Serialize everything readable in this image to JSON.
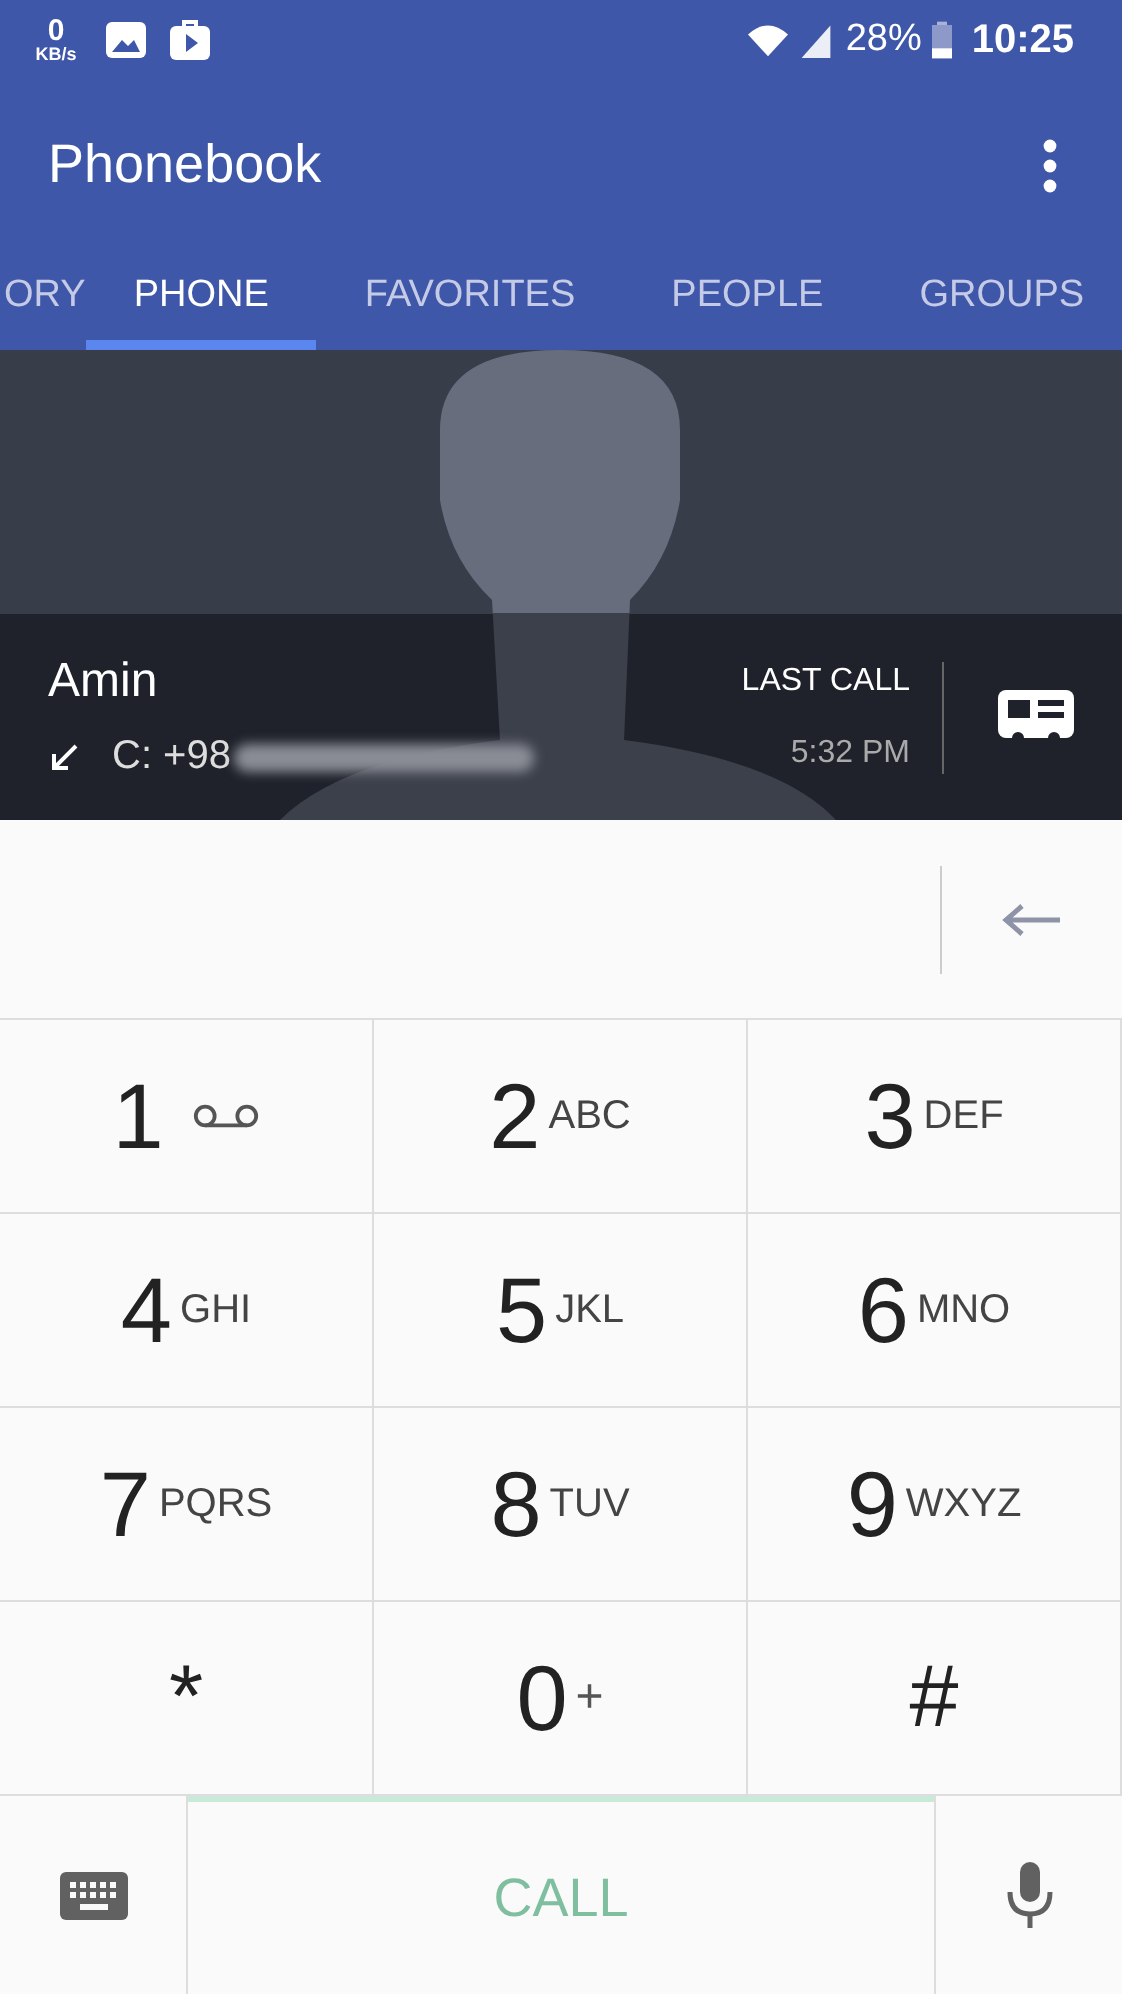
{
  "status_bar": {
    "speed_value": "0",
    "speed_unit": "KB/s",
    "battery": "28%",
    "time": "10:25"
  },
  "app_bar": {
    "title": "Phonebook"
  },
  "tabs": [
    {
      "label": "ORY",
      "selected": false
    },
    {
      "label": "PHONE",
      "selected": true
    },
    {
      "label": "FAVORITES",
      "selected": false
    },
    {
      "label": "PEOPLE",
      "selected": false
    },
    {
      "label": "GROUPS",
      "selected": false
    }
  ],
  "contact": {
    "name": "Amin",
    "number": "C: +98",
    "last_call_label": "LAST CALL",
    "last_call_time": "5:32 PM"
  },
  "keys": [
    {
      "digit": "1",
      "kind": "voicemail"
    },
    {
      "digit": "2",
      "letters": "ABC",
      "kind": "letters"
    },
    {
      "digit": "3",
      "letters": "DEF",
      "kind": "letters"
    },
    {
      "digit": "4",
      "letters": "GHI",
      "kind": "letters"
    },
    {
      "digit": "5",
      "letters": "JKL",
      "kind": "letters"
    },
    {
      "digit": "6",
      "letters": "MNO",
      "kind": "letters"
    },
    {
      "digit": "7",
      "letters": "PQRS",
      "kind": "letters"
    },
    {
      "digit": "8",
      "letters": "TUV",
      "kind": "letters"
    },
    {
      "digit": "9",
      "letters": "WXYZ",
      "kind": "letters"
    },
    {
      "digit": "*",
      "kind": "symbol"
    },
    {
      "digit": "0",
      "letters": "+",
      "kind": "plus"
    },
    {
      "digit": "#",
      "kind": "symbol"
    }
  ],
  "call_button": {
    "label": "CALL",
    "disabled": true
  }
}
